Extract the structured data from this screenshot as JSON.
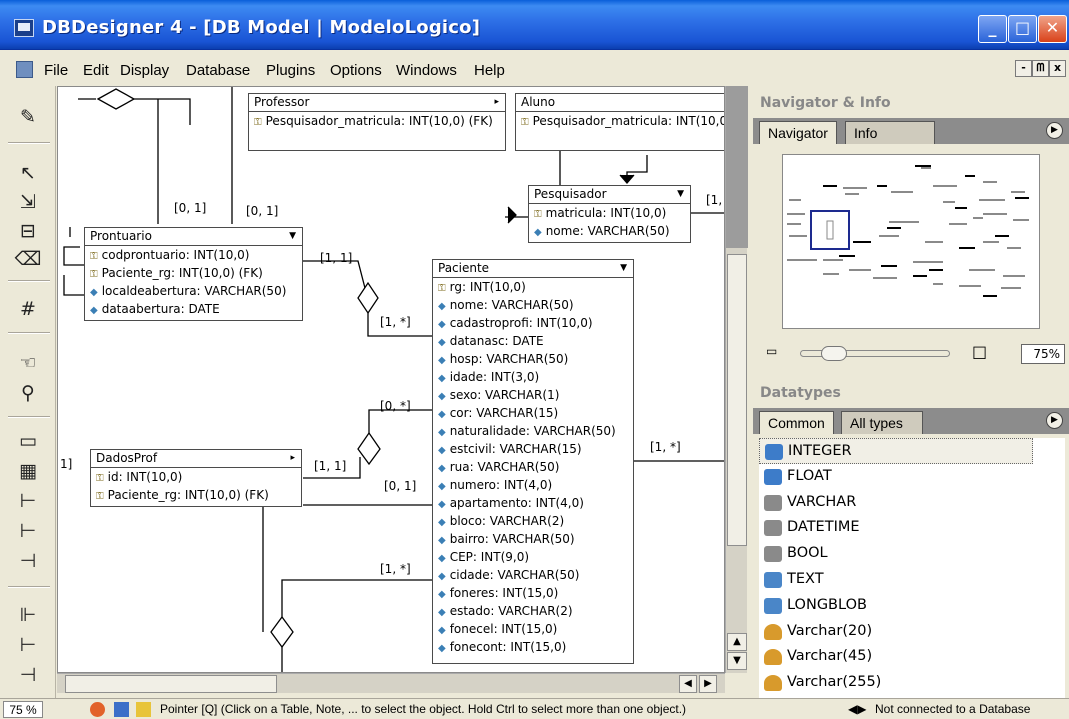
{
  "window": {
    "title": "DBDesigner 4 - [DB Model | ModeloLogico]",
    "controls": {
      "minimize": "_",
      "maximize": "□",
      "close": "✕"
    }
  },
  "menu": {
    "items": [
      "File",
      "Edit",
      "Display",
      "Database",
      "Plugins",
      "Options",
      "Windows",
      "Help"
    ],
    "mdi": [
      "-",
      "ᗰ",
      "x"
    ]
  },
  "toolbox": {
    "tools": [
      "note-icon",
      "pointer-icon",
      "move-icon",
      "table-icon",
      "eraser-icon",
      "grid-icon",
      "hand-icon",
      "zoom-icon",
      "region-icon",
      "image-icon",
      "relation-1n-icon",
      "relation-1n-sub-icon",
      "relation-11-icon",
      "relation-nm-icon",
      "relation-1n2-icon",
      "relation-11b-icon"
    ]
  },
  "canvas": {
    "cardinalities": [
      {
        "id": "c1",
        "text": "[0, 1]"
      },
      {
        "id": "c2",
        "text": "[0, 1]"
      },
      {
        "id": "c3",
        "text": "[1, 1]"
      },
      {
        "id": "c4",
        "text": "[1, *]"
      },
      {
        "id": "c5",
        "text": "[0, *]"
      },
      {
        "id": "c6",
        "text": "[1, 1]"
      },
      {
        "id": "c7",
        "text": "[0, 1]"
      },
      {
        "id": "c8",
        "text": "[1, *]"
      },
      {
        "id": "c9",
        "text": "[1, *]"
      },
      {
        "id": "c10",
        "text": "[1,"
      },
      {
        "id": "c11",
        "text": "1]"
      },
      {
        "id": "c12",
        "text": "[0, *]"
      }
    ],
    "entities": {
      "professor": {
        "name": "Professor",
        "attrs": [
          {
            "kind": "key",
            "text": "Pesquisador_matricula: INT(10,0) (FK)"
          }
        ]
      },
      "aluno": {
        "name": "Aluno",
        "attrs": [
          {
            "kind": "key",
            "text": "Pesquisador_matricula: INT(10,0"
          }
        ]
      },
      "pesquisador": {
        "name": "Pesquisador",
        "attrs": [
          {
            "kind": "key",
            "text": "matricula: INT(10,0)"
          },
          {
            "kind": "data",
            "text": "nome: VARCHAR(50)"
          }
        ]
      },
      "prontuario": {
        "name": "Prontuario",
        "attrs": [
          {
            "kind": "key",
            "text": "codprontuario: INT(10,0)"
          },
          {
            "kind": "key",
            "text": "Paciente_rg: INT(10,0) (FK)"
          },
          {
            "kind": "data",
            "text": "localdeabertura: VARCHAR(50)"
          },
          {
            "kind": "data",
            "text": "dataabertura: DATE"
          }
        ]
      },
      "dadosprof": {
        "name": "DadosProf",
        "attrs": [
          {
            "kind": "key",
            "text": "id: INT(10,0)"
          },
          {
            "kind": "key",
            "text": "Paciente_rg: INT(10,0) (FK)"
          }
        ]
      },
      "paciente": {
        "name": "Paciente",
        "attrs": [
          {
            "kind": "key",
            "text": "rg: INT(10,0)"
          },
          {
            "kind": "data",
            "text": "nome: VARCHAR(50)"
          },
          {
            "kind": "data",
            "text": "cadastroprofi: INT(10,0)"
          },
          {
            "kind": "data",
            "text": "datanasc: DATE"
          },
          {
            "kind": "data",
            "text": "hosp: VARCHAR(50)"
          },
          {
            "kind": "data",
            "text": "idade: INT(3,0)"
          },
          {
            "kind": "data",
            "text": "sexo: VARCHAR(1)"
          },
          {
            "kind": "data",
            "text": "cor: VARCHAR(15)"
          },
          {
            "kind": "data",
            "text": "naturalidade: VARCHAR(50)"
          },
          {
            "kind": "data",
            "text": "estcivil: VARCHAR(15)"
          },
          {
            "kind": "data",
            "text": "rua: VARCHAR(50)"
          },
          {
            "kind": "data",
            "text": "numero: INT(4,0)"
          },
          {
            "kind": "data",
            "text": "apartamento: INT(4,0)"
          },
          {
            "kind": "data",
            "text": "bloco: VARCHAR(2)"
          },
          {
            "kind": "data",
            "text": "bairro: VARCHAR(50)"
          },
          {
            "kind": "data",
            "text": "CEP: INT(9,0)"
          },
          {
            "kind": "data",
            "text": "cidade: VARCHAR(50)"
          },
          {
            "kind": "data",
            "text": "foneres: INT(15,0)"
          },
          {
            "kind": "data",
            "text": "estado: VARCHAR(2)"
          },
          {
            "kind": "data",
            "text": "fonecel: INT(15,0)"
          },
          {
            "kind": "data",
            "text": "fonecont: INT(15,0)"
          }
        ]
      }
    }
  },
  "right_panel": {
    "navigator": {
      "title": "Navigator & Info",
      "tabs": [
        "Navigator",
        "Info"
      ],
      "zoom": "75%"
    },
    "datatypes": {
      "title": "Datatypes",
      "tabs": [
        "Common",
        "All types"
      ],
      "items": [
        "INTEGER",
        "FLOAT",
        "VARCHAR",
        "DATETIME",
        "BOOL",
        "TEXT",
        "LONGBLOB",
        "Varchar(20)",
        "Varchar(45)",
        "Varchar(255)"
      ]
    }
  },
  "status": {
    "zoom": "75 %",
    "message": "Pointer [Q] (Click on a Table, Note, ... to select the object. Hold Ctrl to select more than one object.)",
    "connection": "Not connected to a Database"
  },
  "colors": {
    "titlebar": "#2f72e8",
    "panel_bg": "#ece9d8",
    "key_icon": "#7c6a1c",
    "attr_icon": "#3b7fb5"
  }
}
